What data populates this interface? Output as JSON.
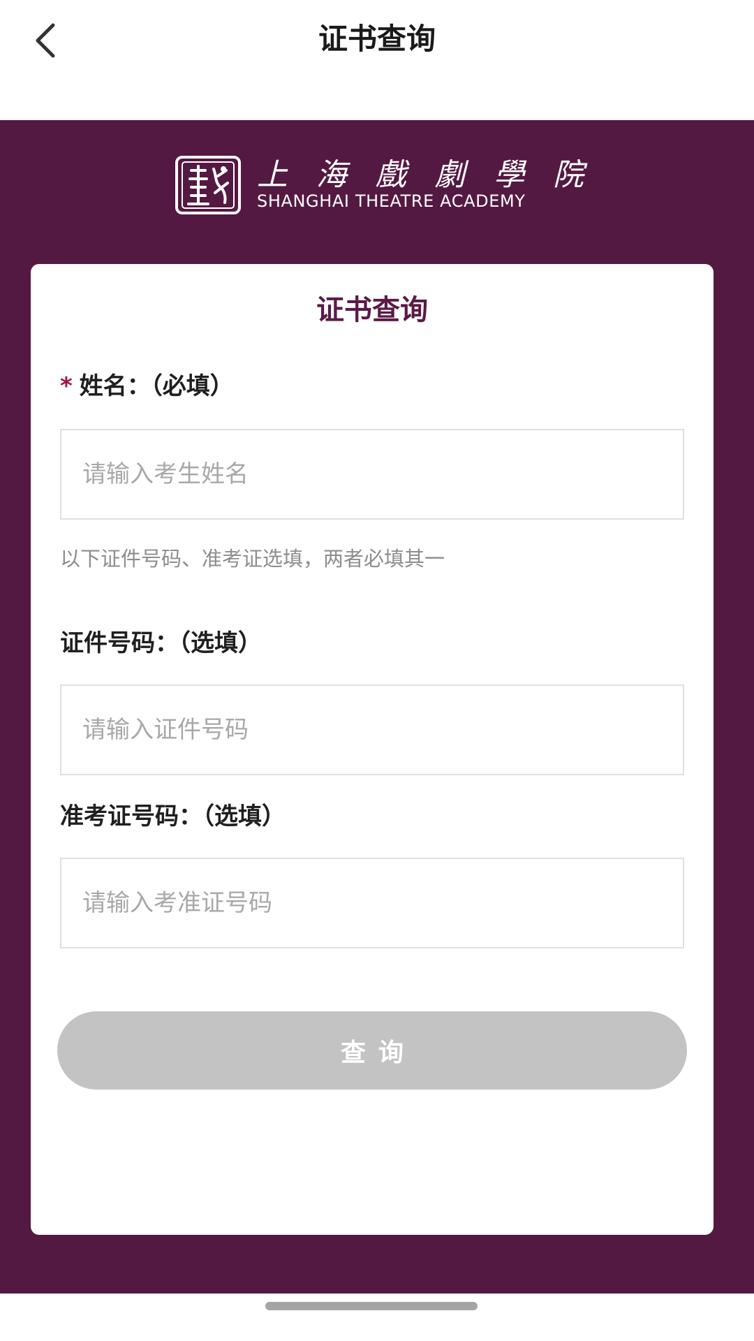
{
  "nav": {
    "title": "证书查询",
    "back_icon": "chevron-left-icon"
  },
  "brand": {
    "name_cn": [
      "上",
      "海",
      "戲",
      "劇",
      "學",
      "院"
    ],
    "name_en": "SHANGHAI THEATRE ACADEMY",
    "background_color": "#541942",
    "accent_color": "#5b1a45"
  },
  "form": {
    "title": "证书查询",
    "required_star": "*",
    "name_label": "姓名：（必填）",
    "name_placeholder": "请输入考生姓名",
    "name_value": "",
    "hint": "以下证件号码、准考证选填，两者必填其一",
    "id_label": "证件号码：（选填）",
    "id_placeholder": "请输入证件号码",
    "id_value": "",
    "ticket_label": "准考证号码：（选填）",
    "ticket_placeholder": "请输入考准证号码",
    "ticket_value": "",
    "submit_label": "查询"
  }
}
